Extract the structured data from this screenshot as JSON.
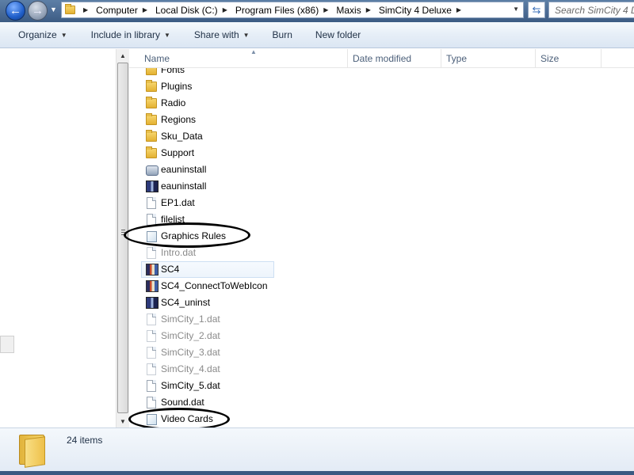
{
  "navigation": {
    "back_icon": "back-arrow-icon",
    "forward_icon": "forward-arrow-icon"
  },
  "address_bar": {
    "breadcrumbs": [
      "Computer",
      "Local Disk (C:)",
      "Program Files (x86)",
      "Maxis",
      "SimCity 4 Deluxe"
    ]
  },
  "search": {
    "placeholder": "Search SimCity 4 D"
  },
  "toolbar": {
    "organize": "Organize",
    "include_in_library": "Include in library",
    "share_with": "Share with",
    "burn": "Burn",
    "new_folder": "New folder"
  },
  "columns": {
    "name": "Name",
    "date_modified": "Date modified",
    "type": "Type",
    "size": "Size"
  },
  "files": [
    {
      "name": "Fonts",
      "icon": "folder-icon"
    },
    {
      "name": "Plugins",
      "icon": "folder-icon"
    },
    {
      "name": "Radio",
      "icon": "folder-icon"
    },
    {
      "name": "Regions",
      "icon": "folder-icon"
    },
    {
      "name": "Sku_Data",
      "icon": "folder-icon"
    },
    {
      "name": "Support",
      "icon": "folder-icon"
    },
    {
      "name": "eauninstall",
      "icon": "setup-icon"
    },
    {
      "name": "eauninstall",
      "icon": "exe-icon"
    },
    {
      "name": "EP1.dat",
      "icon": "file-icon"
    },
    {
      "name": "filelist",
      "icon": "file-icon"
    },
    {
      "name": "Graphics Rules",
      "icon": "config-file-icon"
    },
    {
      "name": "Intro.dat",
      "icon": "file-icon"
    },
    {
      "name": "SC4",
      "icon": "app-icon",
      "selected": true
    },
    {
      "name": "SC4_ConnectToWebIcon",
      "icon": "app-icon"
    },
    {
      "name": "SC4_uninst",
      "icon": "app-icon"
    },
    {
      "name": "SimCity_1.dat",
      "icon": "file-icon"
    },
    {
      "name": "SimCity_2.dat",
      "icon": "file-icon"
    },
    {
      "name": "SimCity_3.dat",
      "icon": "file-icon"
    },
    {
      "name": "SimCity_4.dat",
      "icon": "file-icon"
    },
    {
      "name": "SimCity_5.dat",
      "icon": "file-icon"
    },
    {
      "name": "Sound.dat",
      "icon": "file-icon"
    },
    {
      "name": "Video Cards",
      "icon": "config-file-icon"
    }
  ],
  "details": {
    "item_count": "24 items"
  }
}
